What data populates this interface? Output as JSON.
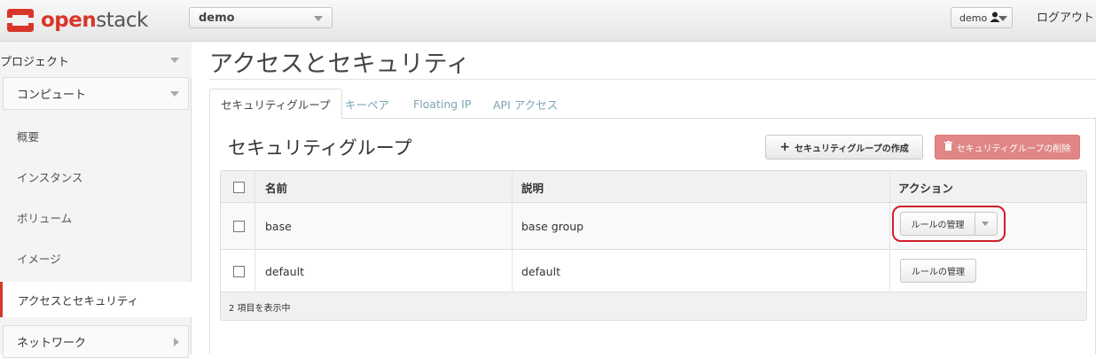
{
  "header": {
    "logo_text_open": "open",
    "logo_text_stack": "stack",
    "project": "demo",
    "user": "demo",
    "logout": "ログアウト"
  },
  "sidebar": {
    "project_label": "プロジェクト",
    "compute_label": "コンピュート",
    "items": [
      {
        "label": "概要",
        "active": false
      },
      {
        "label": "インスタンス",
        "active": false
      },
      {
        "label": "ボリューム",
        "active": false
      },
      {
        "label": "イメージ",
        "active": false
      },
      {
        "label": "アクセスとセキュリティ",
        "active": true
      }
    ],
    "network_label": "ネットワーク"
  },
  "main": {
    "title": "アクセスとセキュリティ",
    "tabs": [
      {
        "label": "セキュリティグループ",
        "active": true
      },
      {
        "label": "キーペア",
        "active": false
      },
      {
        "label": "Floating IP",
        "active": false
      },
      {
        "label": "API アクセス",
        "active": false
      }
    ],
    "panel_title": "セキュリティグループ",
    "create_button": "セキュリティグループの作成",
    "delete_button": "セキュリティグループの削除",
    "table": {
      "columns": [
        "名前",
        "説明",
        "アクション"
      ],
      "rows": [
        {
          "name": "base",
          "description": "base group",
          "action": "ルールの管理"
        },
        {
          "name": "default",
          "description": "default",
          "action": "ルールの管理"
        }
      ],
      "footer": "2 項目を表示中"
    }
  },
  "colors": {
    "accent": "#d9362b",
    "delete_button": "#e08686",
    "tab_link": "#7aa5b5",
    "highlight": "#d0202a"
  },
  "icons": {
    "plus": "plus-icon",
    "trash": "trash-icon",
    "user": "user-icon"
  }
}
